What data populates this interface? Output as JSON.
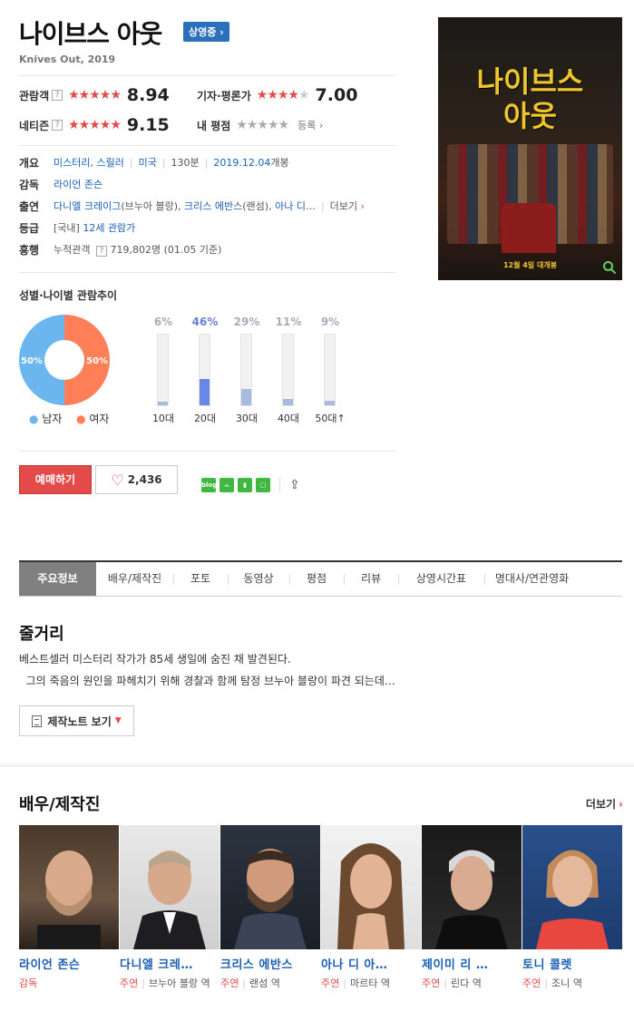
{
  "movie": {
    "title": "나이브스 아웃",
    "status_badge": "상영중",
    "subtitle": "Knives Out, 2019"
  },
  "ratings": {
    "audience": {
      "label": "관람객",
      "score": "8.94",
      "stars": 4.5
    },
    "critic": {
      "label": "기자·평론가",
      "score": "7.00",
      "stars": 3.5
    },
    "netizen": {
      "label": "네티즌",
      "score": "9.15",
      "stars": 4.5
    },
    "mine": {
      "label": "내 평점",
      "register": "등록"
    }
  },
  "info": {
    "overview_label": "개요",
    "genres": [
      "미스터리",
      "스릴러"
    ],
    "country": "미국",
    "runtime": "130분",
    "release": "2019.12.04",
    "release_suffix": "개봉",
    "director_label": "감독",
    "director": "라이언 존슨",
    "cast_label": "출연",
    "cast_1": "다니엘 크레이그",
    "cast_1_role": "(브누아 블랑)",
    "cast_2": "크리스 에반스",
    "cast_2_role": "(랜섬)",
    "cast_3": "아나 디",
    "cast_ellipsis": "…",
    "more": "더보기",
    "grade_label": "등급",
    "grade_region": "[국내]",
    "grade": "12세 관람가",
    "boxoffice_label": "흥행",
    "boxoffice_text": "누적관객",
    "boxoffice_value": "719,802명 (01.05 기준)"
  },
  "poster": {
    "title_line1": "나이브스",
    "title_line2": "아웃",
    "date": "12월 4일 대개봉"
  },
  "stats": {
    "title": "성별·나이별 관람추이",
    "male_pct": "50%",
    "female_pct": "50%",
    "male_label": "남자",
    "female_label": "여자",
    "male_color": "#6cb6f0",
    "female_color": "#ff7f58",
    "ages": [
      {
        "label": "10대",
        "pct": "6%",
        "value": 6
      },
      {
        "label": "20대",
        "pct": "46%",
        "value": 46
      },
      {
        "label": "30대",
        "pct": "29%",
        "value": 29
      },
      {
        "label": "40대",
        "pct": "11%",
        "value": 11
      },
      {
        "label": "50대↑",
        "pct": "9%",
        "value": 9
      }
    ]
  },
  "actions": {
    "reserve": "예매하기",
    "likes": "2,436",
    "share_icons": [
      "blog-icon",
      "cafe-icon",
      "bookmark-icon",
      "memo-icon"
    ]
  },
  "tabs": [
    "주요정보",
    "배우/제작진",
    "포토",
    "동영상",
    "평점",
    "리뷰",
    "상영시간표",
    "명대사/연관영화"
  ],
  "synopsis": {
    "title": "줄거리",
    "line1": "베스트셀러 미스터리 작가가 85세 생일에 숨진 채 발견된다.",
    "line2": "그의 죽음의 원인을 파헤치기 위해 경찰과 함께 탐정 브누아 블랑이 파견 되는데…",
    "note_button": "제작노트 보기"
  },
  "cast_section": {
    "title": "배우/제작진",
    "more": "더보기",
    "people": [
      {
        "name": "라이언 존슨",
        "type": "감독",
        "role": ""
      },
      {
        "name": "다니엘 크레…",
        "type": "주연",
        "role": "브누아 블랑 역"
      },
      {
        "name": "크리스 에반스",
        "type": "주연",
        "role": "랜섬 역"
      },
      {
        "name": "아나 디 아…",
        "type": "주연",
        "role": "마르타 역"
      },
      {
        "name": "제이미 리 …",
        "type": "주연",
        "role": "린다 역"
      },
      {
        "name": "토니 콜렛",
        "type": "주연",
        "role": "조니 역"
      }
    ]
  }
}
